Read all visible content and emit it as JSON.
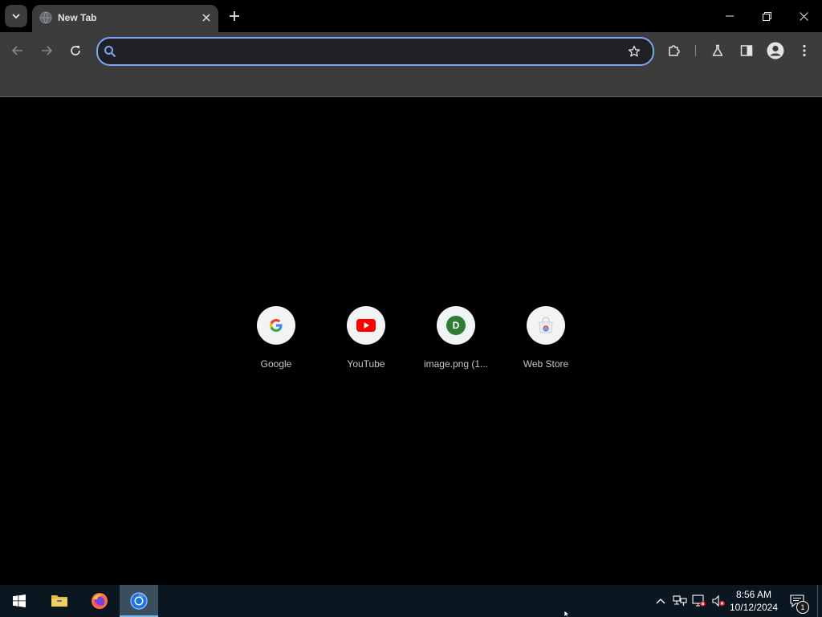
{
  "browser": {
    "tab": {
      "title": "New Tab",
      "favicon": "globe-icon"
    },
    "controls": {
      "tab_search": "chevron-down-icon",
      "close_tab": "close-icon",
      "new_tab": "plus-icon",
      "minimize": "minimize-icon",
      "restore": "restore-icon",
      "close_window": "close-icon"
    },
    "toolbar": {
      "back": "arrow-left-icon",
      "forward": "arrow-right-icon",
      "reload": "reload-icon",
      "omnibox_value": "",
      "omnibox_placeholder": "",
      "bookmark": "star-icon",
      "extensions": "puzzle-icon",
      "labs": "flask-icon",
      "side_panel": "side-panel-icon",
      "profile": "avatar-icon",
      "menu": "kebab-menu-icon"
    }
  },
  "ntp": {
    "shortcuts": [
      {
        "label": "Google",
        "icon": "google-icon"
      },
      {
        "label": "YouTube",
        "icon": "youtube-icon"
      },
      {
        "label": "image.png (1...",
        "icon": "letter-d-icon",
        "badge_letter": "D",
        "badge_color": "#2e7d32"
      },
      {
        "label": "Web Store",
        "icon": "web-store-icon"
      }
    ]
  },
  "taskbar": {
    "apps": [
      {
        "name": "start",
        "icon": "windows-icon",
        "active": false
      },
      {
        "name": "file-explorer",
        "icon": "folder-icon",
        "active": false
      },
      {
        "name": "firefox",
        "icon": "firefox-icon",
        "active": false
      },
      {
        "name": "chrome",
        "icon": "chrome-icon",
        "active": true
      }
    ],
    "tray": [
      "chevron-up-icon",
      "network-icon",
      "network-error-icon",
      "volume-muted-icon"
    ],
    "clock": {
      "time": "8:56 AM",
      "date": "10/12/2024"
    },
    "notifications": {
      "count": "1",
      "icon": "action-center-icon"
    }
  },
  "colors": {
    "background": "#000000",
    "toolbar": "#3c3c3c",
    "omnibox_focus": "#7aa7f5",
    "taskbar": "#0a1620"
  }
}
